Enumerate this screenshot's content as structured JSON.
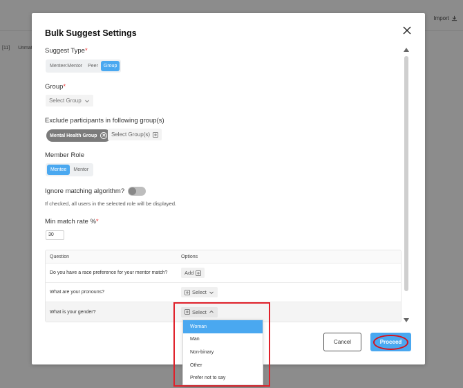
{
  "background": {
    "import_label": "Import",
    "left_items": [
      "[11]",
      "Unmat"
    ]
  },
  "modal": {
    "title": "Bulk Suggest Settings",
    "suggest_type": {
      "label": "Suggest Type",
      "required_mark": "*",
      "options": [
        "Mentee:Mentor",
        "Peer",
        "Group"
      ],
      "selected": "Group"
    },
    "group": {
      "label": "Group",
      "required_mark": "*",
      "placeholder": "Select Group"
    },
    "exclude": {
      "label": "Exclude participants in following group(s)",
      "chip": "Mental Health Group",
      "select_label": "Select Group(s)"
    },
    "member_role": {
      "label": "Member Role",
      "options": [
        "Mentee",
        "Mentor"
      ],
      "selected": "Mentee"
    },
    "ignore_matching": {
      "label": "Ignore matching algorithm?",
      "enabled": false,
      "helper": "If checked, all users in the selected role will be displayed."
    },
    "min_match": {
      "label": "Min match rate %",
      "required_mark": "*",
      "value": "30"
    },
    "table": {
      "headers": [
        "Question",
        "Options"
      ],
      "rows": [
        {
          "question": "Do you have a race preference for your mentor match?",
          "option": "Add"
        },
        {
          "question": "What are your pronouns?",
          "option": "Select"
        },
        {
          "question": "What is your gender?",
          "option": "Select"
        }
      ]
    },
    "dropdown": {
      "items": [
        "Woman",
        "Man",
        "Non-binary",
        "Other",
        "Prefer not to say"
      ],
      "active": "Woman"
    },
    "buttons": {
      "cancel": "Cancel",
      "proceed": "Proceed"
    }
  },
  "colors": {
    "accent": "#4aa8f0",
    "highlight": "#e0202a",
    "overlay": "#8c8c8c"
  }
}
